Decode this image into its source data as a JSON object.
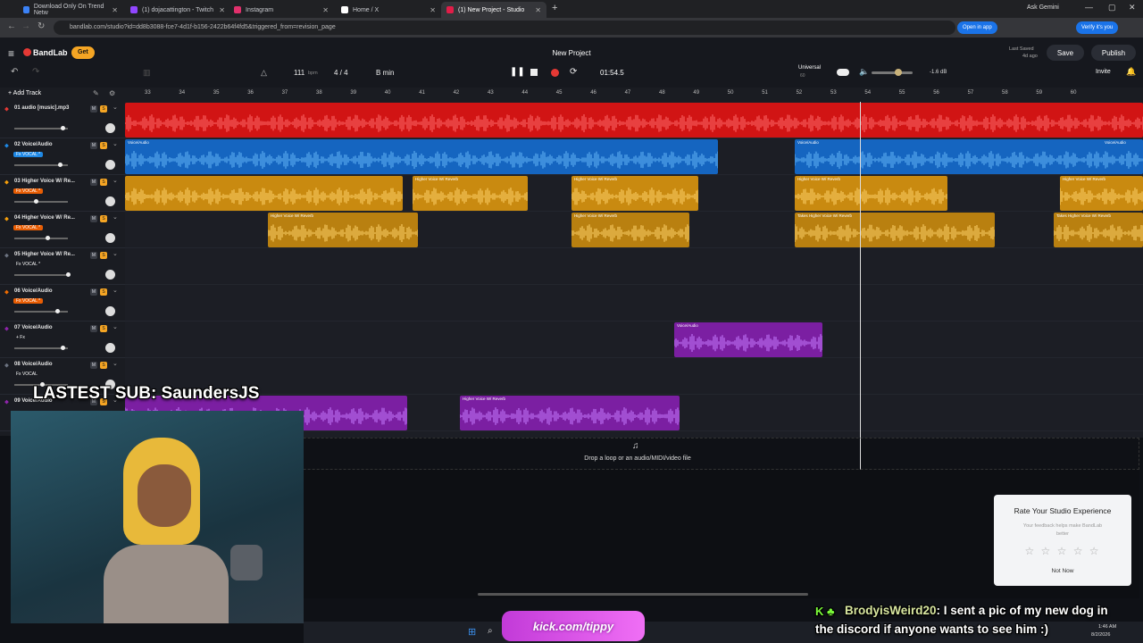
{
  "browser": {
    "tabs": [
      {
        "title": "Download Only On Trend Netw",
        "color": "#3b82f6"
      },
      {
        "title": "(1) dojacattington - Twitch",
        "color": "#9146ff"
      },
      {
        "title": "Instagram",
        "color": "#e1306c"
      },
      {
        "title": "Home / X",
        "color": "#ffffff"
      },
      {
        "title": "(1) New Project - Studio",
        "color": "#e11d48"
      }
    ],
    "new_tab": "+",
    "gemini": "Ask Gemini",
    "url": "bandlab.com/studio?id=dd8b3088-fce7-4d1f-b156-2422b64f4fd5&triggered_from=revision_page",
    "open_in_app": "Open in app",
    "verify": "Verify it's you"
  },
  "app": {
    "logo": "BandLab",
    "get": "Get",
    "project_title": "New Project",
    "last_saved": "Last Saved",
    "saved_ago": "4d ago",
    "save": "Save",
    "publish": "Publish",
    "invite": "Invite",
    "tempo": "111",
    "bpm": "bpm",
    "time_sig": "4 / 4",
    "key": "B min",
    "time": "01:54.5",
    "preset_name": "Universal",
    "preset_sub": "60",
    "volume_db": "-1.6 dB",
    "add_track": "Add Track"
  },
  "ruler": [
    "33",
    "34",
    "35",
    "36",
    "37",
    "38",
    "39",
    "40",
    "41",
    "42",
    "43",
    "44",
    "45",
    "46",
    "47",
    "48",
    "49",
    "50",
    "51",
    "52",
    "53",
    "54",
    "55",
    "56",
    "57",
    "58",
    "59",
    "60"
  ],
  "tracks": [
    {
      "name": "01 audio [music].mp3",
      "fx": "",
      "color": "#e53935",
      "vol": 0.9
    },
    {
      "name": "02 Voice/Audio",
      "fx": "Fx VOCAL *",
      "color": "#1e88e5",
      "vol": 0.85
    },
    {
      "name": "03 Higher Voice W/ Re...",
      "fx": "Fx VOCAL *",
      "color": "#f59e0b",
      "vol": 0.38
    },
    {
      "name": "04 Higher Voice W/ Re...",
      "fx": "Fx VOCAL *",
      "color": "#f59e0b",
      "vol": 0.6
    },
    {
      "name": "05 Higher Voice W/ Re...",
      "fx": "Fx VOCAL *",
      "color": "#6b7280",
      "vol": 1.0
    },
    {
      "name": "06 Voice/Audio",
      "fx": "Fx VOCAL *",
      "color": "#ef6c00",
      "vol": 0.8
    },
    {
      "name": "07 Voice/Audio",
      "fx": "+ Fx",
      "color": "#8e24aa",
      "vol": 0.9
    },
    {
      "name": "08 Voice/Audio",
      "fx": "Fx VOCAL",
      "color": "#6b7280",
      "vol": 0.5
    },
    {
      "name": "09 Voice/Audio",
      "fx": "",
      "color": "#8e24aa",
      "vol": 0.5
    }
  ],
  "clips": [
    {
      "lane": 0,
      "label": "",
      "color": "#d11414",
      "wave": "#ff6b6b"
    },
    {
      "lane": 1,
      "label": "Voice/Audio",
      "color": "#1565c0",
      "wave": "#64b5f6"
    },
    {
      "lane": 1,
      "label": "Voice/Audio",
      "color": "#1565c0",
      "wave": "#64b5f6"
    },
    {
      "lane": 1,
      "label": "Voice/Audio",
      "color": "#1565c0",
      "wave": "#64b5f6"
    },
    {
      "lane": 2,
      "label": "",
      "color": "#c98a10",
      "wave": "#ffd36b"
    },
    {
      "lane": 2,
      "label": "Higher Voice W/ Reverb",
      "color": "#c98a10",
      "wave": "#ffd36b"
    },
    {
      "lane": 2,
      "label": "Higher Voice W/ Reverb",
      "color": "#c98a10",
      "wave": "#ffd36b"
    },
    {
      "lane": 2,
      "label": "Higher Voice W/ Reverb",
      "color": "#c98a10",
      "wave": "#ffd36b"
    },
    {
      "lane": 2,
      "label": "Higher Voice W/ Reverb",
      "color": "#c98a10",
      "wave": "#ffd36b"
    },
    {
      "lane": 3,
      "label": "Higher Voice W/ Reverb",
      "color": "#b98010",
      "wave": "#ffd36b"
    },
    {
      "lane": 3,
      "label": "Higher Voice W/ Reverb",
      "color": "#b98010",
      "wave": "#ffd36b"
    },
    {
      "lane": 3,
      "label": "Takes  Higher Voice W/ Reverb",
      "color": "#b98010",
      "wave": "#ffd36b"
    },
    {
      "lane": 3,
      "label": "Takes  Higher Voice W/ Reverb",
      "color": "#b98010",
      "wave": "#ffd36b"
    },
    {
      "lane": 6,
      "label": "Voice/Audio",
      "color": "#7b1fa2",
      "wave": "#c77dff"
    },
    {
      "lane": 8,
      "label": "",
      "color": "#7b1fa2",
      "wave": "#c77dff"
    },
    {
      "lane": 8,
      "label": "Higher Voice W/ Reverb",
      "color": "#7b1fa2",
      "wave": "#c77dff"
    }
  ],
  "drop_text": "Drop a loop or an audio/MIDI/video file",
  "rate": {
    "title": "Rate Your Studio Experience",
    "sub": "Your feedback helps make BandLab better",
    "not_now": "Not Now",
    "stars": "☆ ☆ ☆ ☆ ☆"
  },
  "overlay": {
    "latest_sub": "LASTEST SUB: SaundersJS",
    "chat_user": "BrodyisWeird20",
    "chat_msg1": ": I sent a pic of my new dog in",
    "chat_msg2": "the discord if anyone wants to see him :)",
    "kick": "kick.com/tippy"
  },
  "taskbar": {
    "time": "1:46 AM",
    "date": "8/2/2026"
  }
}
